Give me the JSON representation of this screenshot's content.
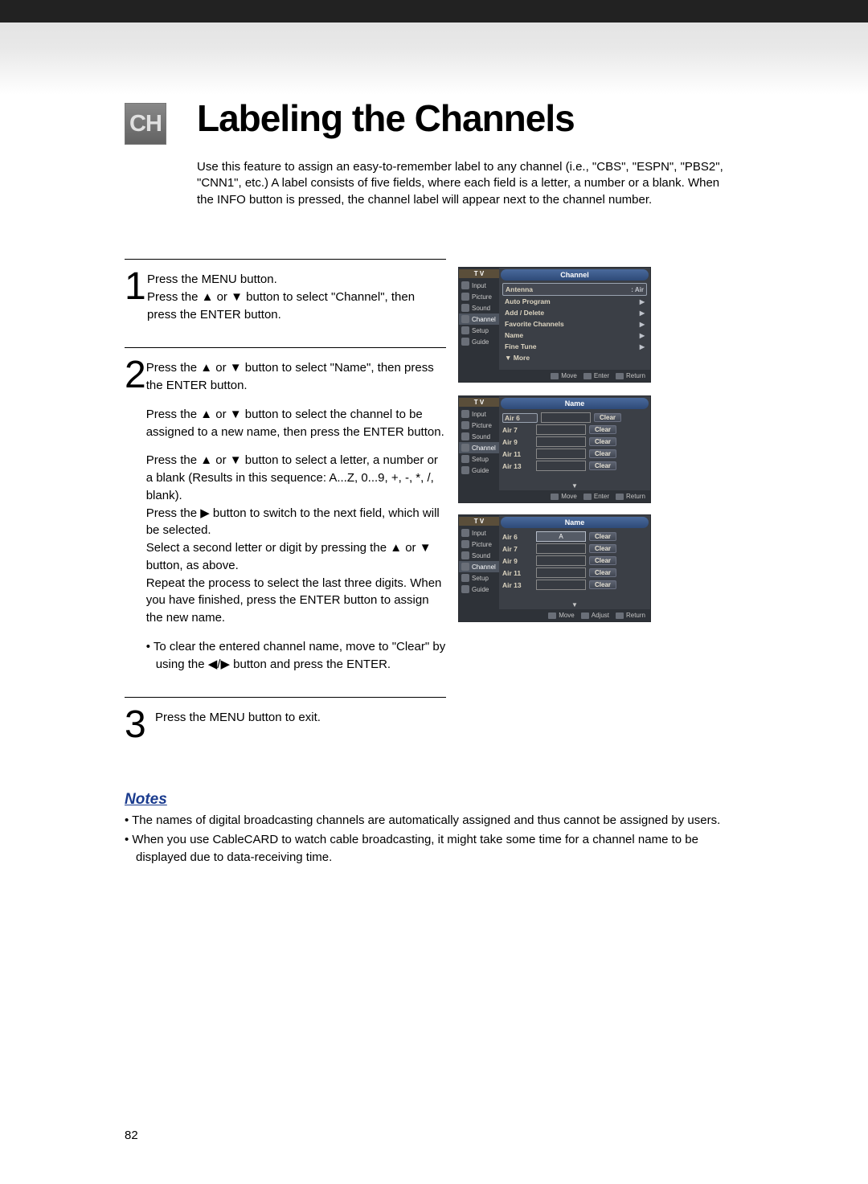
{
  "badge": "CH",
  "title": "Labeling the Channels",
  "intro": "Use this feature to assign an easy-to-remember label to any channel (i.e., \"CBS\", \"ESPN\", \"PBS2\", \"CNN1\", etc.) A label consists of five fields, where each field is a letter, a number or a blank. When the INFO button is pressed, the channel label will appear next to the channel number.",
  "steps": [
    {
      "num": "1",
      "paras": [
        "Press the MENU button.\nPress the ▲ or ▼ button to select \"Channel\", then press the ENTER button."
      ]
    },
    {
      "num": "2",
      "paras": [
        "Press the ▲ or ▼ button to select \"Name\", then press the ENTER button.",
        "Press the ▲ or ▼ button to select the channel to be assigned to a new name, then press the ENTER button.",
        "Press the ▲ or ▼ button to select a letter, a number or a blank (Results in this sequence: A...Z, 0...9, +, -, *, /, blank).\nPress the ▶ button to switch to the next field, which will be selected.\nSelect a second letter or digit by pressing the ▲ or ▼ button, as above.\nRepeat the process to select the last three digits. When you have finished, press the ENTER button to assign the new name.",
        "• To clear the entered channel name, move to \"Clear\" by using the ◀/▶ button and press the ENTER."
      ]
    },
    {
      "num": "3",
      "paras": [
        "Press the MENU button to exit."
      ]
    }
  ],
  "notes_title": "Notes",
  "notes": [
    "• The names of digital broadcasting channels are automatically assigned and thus cannot be assigned by users.",
    "• When you use CableCARD to watch cable broadcasting, it might take some time for a channel name to be displayed due to data-receiving time."
  ],
  "page_number": "82",
  "osd": {
    "tv": "T V",
    "side_items": [
      "Input",
      "Picture",
      "Sound",
      "Channel",
      "Setup",
      "Guide"
    ],
    "screen1": {
      "title": "Channel",
      "menu": [
        {
          "label": "Antenna",
          "value": ": Air",
          "boxed": true
        },
        {
          "label": "Auto Program",
          "value": "▶"
        },
        {
          "label": "Add / Delete",
          "value": "▶"
        },
        {
          "label": "Favorite Channels",
          "value": "▶"
        },
        {
          "label": "Name",
          "value": "▶"
        },
        {
          "label": "Fine Tune",
          "value": "▶"
        },
        {
          "label": "▼ More",
          "value": ""
        }
      ],
      "footer": [
        {
          "icon": "↕",
          "label": "Move"
        },
        {
          "icon": "⏎",
          "label": "Enter"
        },
        {
          "icon": "▭",
          "label": "Return"
        }
      ]
    },
    "screen2": {
      "title": "Name",
      "rows": [
        {
          "ch": "Air 6",
          "val": "",
          "clear": "Clear",
          "sel": true
        },
        {
          "ch": "Air 7",
          "val": "",
          "clear": "Clear"
        },
        {
          "ch": "Air 9",
          "val": "",
          "clear": "Clear"
        },
        {
          "ch": "Air 11",
          "val": "",
          "clear": "Clear"
        },
        {
          "ch": "Air 13",
          "val": "",
          "clear": "Clear"
        }
      ],
      "footer": [
        {
          "icon": "↔",
          "label": "Move"
        },
        {
          "icon": "⏎",
          "label": "Enter"
        },
        {
          "icon": "▭",
          "label": "Return"
        }
      ]
    },
    "screen3": {
      "title": "Name",
      "rows": [
        {
          "ch": "Air 6",
          "val": "A",
          "clear": "Clear",
          "fsel": true
        },
        {
          "ch": "Air 7",
          "val": "",
          "clear": "Clear"
        },
        {
          "ch": "Air 9",
          "val": "",
          "clear": "Clear"
        },
        {
          "ch": "Air 11",
          "val": "",
          "clear": "Clear"
        },
        {
          "ch": "Air 13",
          "val": "",
          "clear": "Clear"
        }
      ],
      "footer": [
        {
          "icon": "↔",
          "label": "Move"
        },
        {
          "icon": "↕",
          "label": "Adjust"
        },
        {
          "icon": "▭",
          "label": "Return"
        }
      ]
    }
  }
}
